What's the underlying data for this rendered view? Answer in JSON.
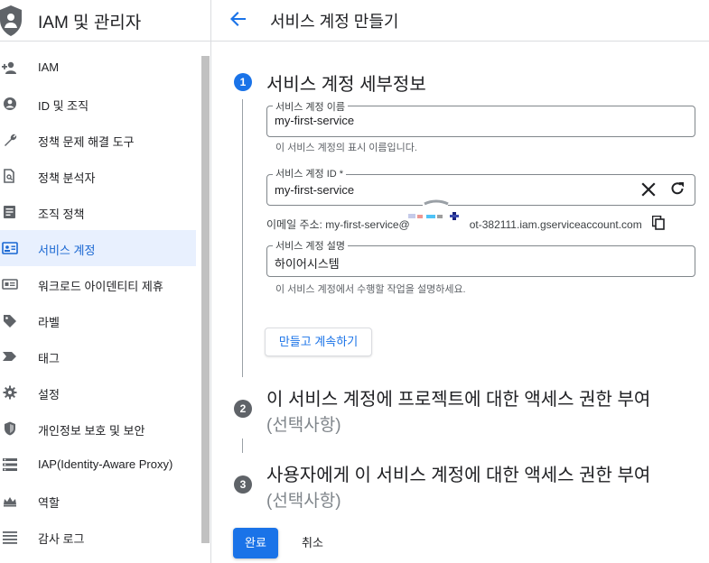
{
  "sidebar": {
    "title": "IAM 및 관리자",
    "items": [
      {
        "label": "IAM",
        "icon": "person-add-icon"
      },
      {
        "label": "ID 및 조직",
        "icon": "account-circle-icon"
      },
      {
        "label": "정책 문제 해결 도구",
        "icon": "wrench-icon"
      },
      {
        "label": "정책 분석자",
        "icon": "document-search-icon"
      },
      {
        "label": "조직 정책",
        "icon": "article-icon"
      },
      {
        "label": "서비스 계정",
        "icon": "service-account-icon",
        "active": true
      },
      {
        "label": "워크로드 아이덴티티 제휴",
        "icon": "id-card-icon"
      },
      {
        "label": "라벨",
        "icon": "label-icon"
      },
      {
        "label": "태그",
        "icon": "tag-icon"
      },
      {
        "label": "설정",
        "icon": "gear-icon"
      },
      {
        "label": "개인정보 보호 및 보안",
        "icon": "shield-icon"
      },
      {
        "label": "IAP(Identity-Aware Proxy)",
        "icon": "proxy-icon"
      },
      {
        "label": "역할",
        "icon": "roles-icon"
      },
      {
        "label": "감사 로그",
        "icon": "list-icon"
      }
    ]
  },
  "header": {
    "title": "서비스 계정 만들기"
  },
  "steps": [
    {
      "number": "1",
      "title": "서비스 계정 세부정보"
    },
    {
      "number": "2",
      "title": "이 서비스 계정에 프로젝트에 대한 액세스 권한 부여",
      "optional": "(선택사항)"
    },
    {
      "number": "3",
      "title": "사용자에게 이 서비스 계정에 대한 액세스 권한 부여",
      "optional": "(선택사항)"
    }
  ],
  "form": {
    "name": {
      "label": "서비스 계정 이름",
      "value": "my-first-service",
      "helper": "이 서비스 계정의 표시 이름입니다."
    },
    "id": {
      "label": "서비스 계정 ID *",
      "value": "my-first-service"
    },
    "email": {
      "prefix": "이메일 주소: my-first-service@",
      "suffix": "ot-382111.iam.gserviceaccount.com"
    },
    "description": {
      "label": "서비스 계정 설명",
      "value": "하이어시스템",
      "helper": "이 서비스 계정에서 수행할 작업을 설명하세요."
    },
    "create_continue": "만들고 계속하기"
  },
  "actions": {
    "done": "완료",
    "cancel": "취소"
  },
  "colors": {
    "accent": "#1a73e8",
    "active_bg": "#e8f0fe",
    "inactive_step": "#5f6368"
  }
}
